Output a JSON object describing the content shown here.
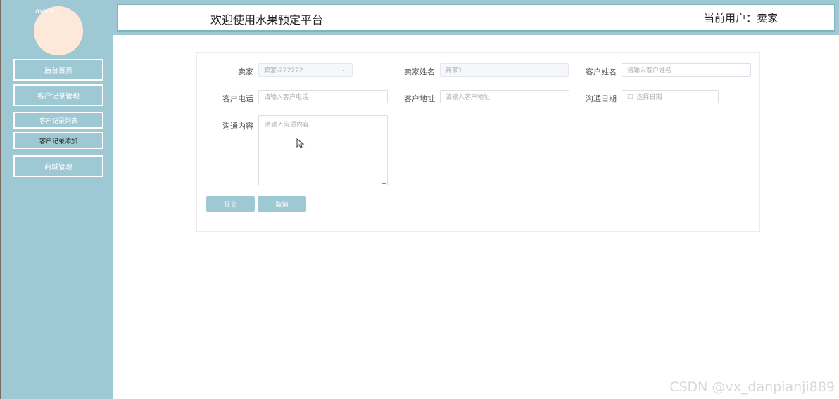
{
  "sidebar": {
    "avatar_alt": "avatar",
    "items": [
      {
        "label": "后台首页"
      },
      {
        "label": "客户记录管理"
      },
      {
        "label": "客户记录列表"
      },
      {
        "label": "客户记录添加"
      },
      {
        "label": "商城管理"
      }
    ]
  },
  "header": {
    "title": "欢迎使用水果预定平台",
    "current_user": "当前用户：卖家"
  },
  "form": {
    "seller": {
      "label": "卖家",
      "value": "卖家-222222"
    },
    "seller_name": {
      "label": "卖家姓名",
      "value": "商家1"
    },
    "customer_name": {
      "label": "客户姓名",
      "placeholder": "请输入客户姓名"
    },
    "customer_phone": {
      "label": "客户电话",
      "placeholder": "请输入客户电话"
    },
    "customer_address": {
      "label": "客户地址",
      "placeholder": "请输入客户地址"
    },
    "contact_date": {
      "label": "沟通日期",
      "placeholder": "选择日期"
    },
    "contact_content": {
      "label": "沟通内容",
      "placeholder": "请输入沟通内容"
    },
    "submit_label": "提交",
    "cancel_label": "取消"
  },
  "watermark": "CSDN @vx_danpianji889",
  "colors": {
    "sidebar_bg": "#9ec8d3",
    "avatar_bg": "#fde8da",
    "button_bg": "#9ec8d3"
  }
}
